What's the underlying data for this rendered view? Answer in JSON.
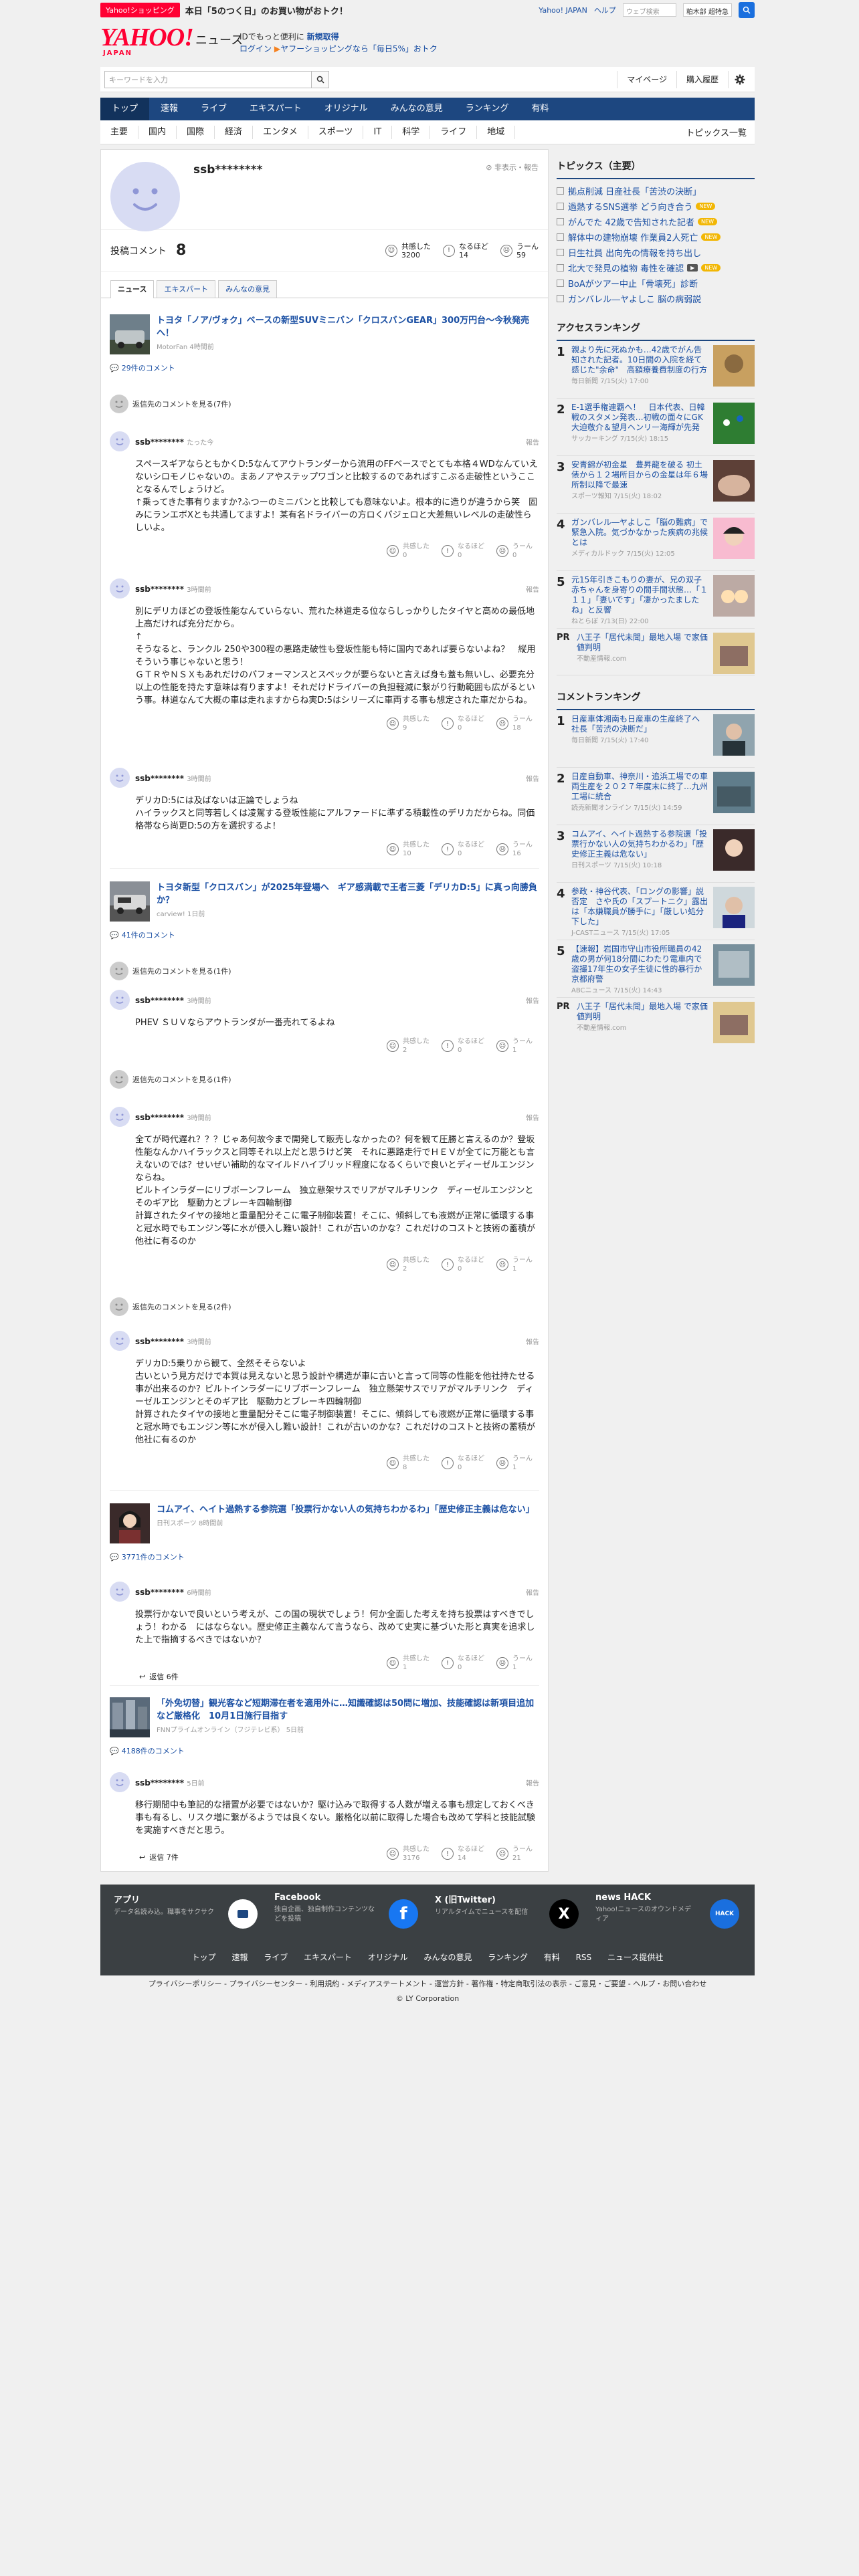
{
  "topbar": {
    "badge": "Yahoo!ショッピング",
    "promo": "本日「5のつく日」のお買い物がおトク！",
    "links": [
      "Yahoo! JAPAN",
      "ヘルプ"
    ],
    "search_placeholder": "ウェブ検索",
    "select": "粕木部 超特急"
  },
  "header": {
    "logo": "YAHOO!",
    "logo_sub": "JAPAN",
    "site": "ニュース",
    "note_line1_a": "IDでもっと便利に",
    "note_line1_b": "新規取得",
    "note_login": "ログイン",
    "note_line2": "ヤフーショッピングなら「毎日5%」おトク"
  },
  "search": {
    "placeholder": "キーワードを入力",
    "mypage": "マイページ",
    "purchase": "購入履歴"
  },
  "nav": [
    "トップ",
    "速報",
    "ライブ",
    "エキスパート",
    "オリジナル",
    "みんなの意見",
    "ランキング",
    "有料"
  ],
  "subnav": [
    "主要",
    "国内",
    "国際",
    "経済",
    "エンタメ",
    "スポーツ",
    "IT",
    "科学",
    "ライフ",
    "地域"
  ],
  "subnav_right": "トピックス一覧",
  "profile": {
    "name": "ssb********",
    "hide": "非表示・報告",
    "comment_label": "投稿コメント",
    "comment_count": "8",
    "stats": [
      {
        "label": "共感した",
        "value": "3200"
      },
      {
        "label": "なるほど",
        "value": "14"
      },
      {
        "label": "うーん",
        "value": "59"
      }
    ],
    "tabs": [
      "ニュース",
      "エキスパート",
      "みんなの意見"
    ]
  },
  "articles": [
    {
      "title": "トヨタ「ノア/ヴォク」ベースの新型SUVミニバン「クロスバンGEAR」300万円台〜今秋発売へ！",
      "source": "MotorFan 4時間前",
      "count": "29件のコメント"
    },
    {
      "title": "トヨタ新型「クロスバン」が2025年登場へ　ギア感満載で王者三菱「デリカD:5」に真っ向勝負か？",
      "source": "carview! 1日前",
      "count": "41件のコメント"
    },
    {
      "title": "コムアイ、ヘイト過熱する参院選「投票行かない人の気持ちわかるわ」「歴史修正主義は危ない」",
      "source": "日刊スポーツ 8時間前",
      "count": "3771件のコメント"
    },
    {
      "title": "「外免切替」観光客など短期滞在者を適用外に…知識確認は50問に増加、技能確認は新項目追加など厳格化　10月1日施行目指す",
      "source": "FNNプライムオンライン（フジテレビ系） 5日前",
      "count": "4188件のコメント"
    }
  ],
  "see_prev": [
    "返信先のコメントを見る(7件)",
    "返信先のコメントを見る(1件)",
    "返信先のコメントを見る(1件)",
    "返信先のコメントを見る(2件)"
  ],
  "comments": [
    {
      "name": "ssb********",
      "time": "たった今",
      "report": "報告",
      "body": "スペースギアならともかくD:5なんてアウトランダーから流用のFFベースでとても本格４WDなんていえないシロモノじゃないの。まあノアやステップワゴンと比較するのであればすこぶる走破性というこことなるんでしょうけど。\n↑乗ってきた事有りますか?ふつーのミニバンと比較しても意味ないよ。根本的に造りが違うから笑　固みにランエボXとも共通してますよ！某有名ドライバーの方ロくパジェロと大差無いレベルの走破性らしいよ。",
      "r": [
        "0",
        "0",
        "0"
      ]
    },
    {
      "name": "ssb********",
      "time": "3時間前",
      "report": "報告",
      "body": "別にデリカほどの登坂性能なんていらない、荒れた林道走る位ならしっかりしたタイヤと高めの最低地上高だければ充分だから。\n↑\nそうなると、ランクル 250や300程の悪路走破性も登坂性能も特に国内であれば要らないよね？　縦用そういう事じゃないと思う！\nＧＴＲやＮＳＸもあれだけのパフォーマンスとスペックが要らないと言えば身も蓋も無いし、必要充分以上の性能を持たす意味は有りますよ！それだけドライバーの負担軽減に繋がり行動範囲も広がるという事。林道なんて大概の車は走れますからね実D:5はシリーズに車両する事も想定された車だからね。",
      "r": [
        "9",
        "0",
        "18"
      ]
    },
    {
      "name": "ssb********",
      "time": "3時間前",
      "report": "報告",
      "body": "デリカD:5には及ばないは正論でしょうね\nハイラックスと同等若しくは凌駕する登坂性能にアルファードに準ずる積載性のデリカだからね。同価格帯なら尚更D:5の方を選択するよ！",
      "r": [
        "10",
        "0",
        "16"
      ]
    },
    {
      "name": "ssb********",
      "time": "3時間前",
      "report": "報告",
      "body": "PHEV ＳＵＶならアウトランダが一番売れてるよね",
      "r": [
        "2",
        "0",
        "1"
      ]
    },
    {
      "name": "ssb********",
      "time": "3時間前",
      "report": "報告",
      "body": "全てが時代遅れ？？？じゃあ何故今まで開発して販売しなかったの？何を観て圧勝と言えるのか？登坂性能なんかハイラックスと同等それ以上だと思うけど笑　それに悪路走行でＨＥＶが全てに万能とも言えないのでは？せいぜい補助的なマイルドハイブリッド程度になるくらいで良いとディーゼルエンジンならね。\nビルトインラダーにリブボーンフレーム　独立懸架サスでリアがマルチリンク　ディーゼルエンジンとそのギア比　駆動力とブレーキ四輪制御\n計算されたタイヤの接地と重量配分そこに電子制御装置！そこに、傾斜しても液燃が正常に循環する事と冠水時でもエンジン等に水が侵入し難い設計！これが古いのかな？これだけのコストと技術の蓄積が他社に有るのか",
      "r": [
        "2",
        "0",
        "1"
      ]
    },
    {
      "name": "ssb********",
      "time": "3時間前",
      "report": "報告",
      "body": "デリカD:5乗りから観て、全然そそらないよ\n古いという見方だけで本質は見えないと思う設計や構造が車に古いと言って同等の性能を他社持たせる事が出来るのか？ビルトインラダーにリブボーンフレーム　独立懸架サスでリアがマルチリンク　ディーゼルエンジンとそのギア比　駆動力とブレーキ四輪制御\n計算されたタイヤの接地と重量配分そこに電子制御装置！そこに、傾斜しても液燃が正常に循環する事と冠水時でもエンジン等に水が侵入し難い設計！これが古いのかな？これだけのコストと技術の蓄積が他社に有るのか",
      "r": [
        "8",
        "0",
        "1"
      ]
    },
    {
      "name": "ssb********",
      "time": "6時間前",
      "report": "報告",
      "body": "投票行かないで良いという考えが、この国の現状でしょう！何か全面した考えを持ち投票はすべきでしょう！わかる　にはならない。歴史修正主義なんて言うなら、改めて史実に基づいた形と真実を追求した上で指摘するべきではないか？",
      "reply": "返信 6件",
      "r": [
        "1",
        "0",
        "1"
      ]
    },
    {
      "name": "ssb********",
      "time": "5日前",
      "report": "報告",
      "body": "移行期間中も筆記的な措置が必要ではないか？駆け込みで取得する人数が増える事も想定しておくべき事も有るし、リスク増に繋がるようでは良くない。厳格化以前に取得した場合も改めて学科と技能試験を実施すべきだと思う。",
      "reply": "返信 7件",
      "r": [
        "3176",
        "14",
        "21"
      ]
    }
  ],
  "react_labels": [
    "共感した",
    "なるほど",
    "うーん"
  ],
  "side": {
    "topics_title": "トピックス（主要）",
    "topics": [
      {
        "t": "拠点削減 日産社長「苦渋の決断」",
        "b": ""
      },
      {
        "t": "過熱するSNS選挙 どう向き合う",
        "b": "NEW"
      },
      {
        "t": "がんでた 42歳で告知された記者",
        "b": "NEW"
      },
      {
        "t": "解体中の建物崩壊 作業員2人死亡",
        "b": "NEW"
      },
      {
        "t": "日生社員 出向先の情報を持ち出し",
        "b": ""
      },
      {
        "t": "北大で発見の植物 毒性を確認",
        "b": "NEW"
      },
      {
        "t": "BoAがツアー中止「骨壊死」診断",
        "b": ""
      },
      {
        "t": "ガンバレル―ヤよしこ 脳の病弱説",
        "b": ""
      }
    ],
    "access_title": "アクセスランキング",
    "access": [
      {
        "n": "1",
        "t": "親より先に死ぬかも…42歳でがん告知された記者。10日間の入院を経て感じた\"余命\"　高額療養費制度の行方",
        "s": "毎日新聞 7/15(火) 17:00"
      },
      {
        "n": "2",
        "t": "E-1選手権連覇へ！　日本代表、日韓戦のスタメン発表…初戦の面々にGK大迫敬介＆望月ヘンリー海輝が先発",
        "s": "サッカーキング 7/15(火) 18:15"
      },
      {
        "n": "3",
        "t": "安青錦が初金星　豊昇龍を破る 初土俵から１２場所目からの金星は年６場所制以降で最速",
        "s": "スポーツ報知 7/15(火) 18:02"
      },
      {
        "n": "4",
        "t": "ガンバレル―ヤよしこ「脳の難病」で緊急入院。気づかなかった疾病の兆候とは",
        "s": "メディカルドック 7/15(火) 12:05"
      },
      {
        "n": "5",
        "t": "元15年引きこもりの妻が、兄の双子赤ちゃんを身寄りの間手間状態…「１１１」「妻いです」「凄かったましたね」と反響",
        "s": "ねとらぼ 7/13(日) 22:00"
      }
    ],
    "pr1": {
      "t": "八王子「居代未聞」最地入場 で家価値判明",
      "s": "不動産情報.com"
    },
    "comment_title": "コメントランキング",
    "comment_rank": [
      {
        "n": "1",
        "t": "日産車体湘南も日産車の生産終了へ　社長「苦渋の決断だ」",
        "s": "毎日新聞 7/15(火) 17:40"
      },
      {
        "n": "2",
        "t": "日産自動車、神奈川・追浜工場での車両生産を２０２７年度末に終了…九州工場に統合",
        "s": "読売新聞オンライン 7/15(火) 14:59"
      },
      {
        "n": "3",
        "t": "コムアイ、ヘイト過熱する参院選「投票行かない人の気持ちわかるわ」「歴史修正主義は危ない」",
        "s": "日刊スポーツ 7/15(火) 10:18"
      },
      {
        "n": "4",
        "t": "参政・神谷代表、「ロングの影響」説否定　さや氏の「スプートニク」露出は「本嫌職員が勝手に」「厳しい処分下した」",
        "s": "J-CASTニュース 7/15(火) 17:05"
      },
      {
        "n": "5",
        "t": "【速報】岩国市守山市役所職員の42歳の男が何18分間にわたり電車内で盗撮17年生の女子生徒に性的暴行か　京都府警",
        "s": "ABCニュース 7/15(火) 14:43"
      }
    ],
    "pr2": {
      "t": "八王子「居代未聞」最地入場 で家価値判明",
      "s": "不動産情報.com"
    }
  },
  "footer": {
    "boxes": [
      {
        "t": "アプリ",
        "d": "データ名読み込。職事をサクサク"
      },
      {
        "t": "Facebook",
        "d": "独自企画、独自制作コンテンツなどを投稿"
      },
      {
        "t": "X (旧Twitter)",
        "d": "リアルタイムでニュースを配信"
      },
      {
        "t": "news HACK",
        "d": "Yahoo!ニュースのオウンドメディア"
      }
    ],
    "links": [
      "トップ",
      "速報",
      "ライブ",
      "エキスパート",
      "オリジナル",
      "みんなの意見",
      "ランキング",
      "有料",
      "RSS",
      "ニュース提供社"
    ],
    "legal": "プライバシーポリシー - プライバシーセンター - 利用規約 - メディアステートメント - 運営方針 - 著作権・特定商取引法の表示 - ご意見・ご要望 - ヘルプ・お問い合わせ",
    "copyright": "© LY Corporation"
  }
}
